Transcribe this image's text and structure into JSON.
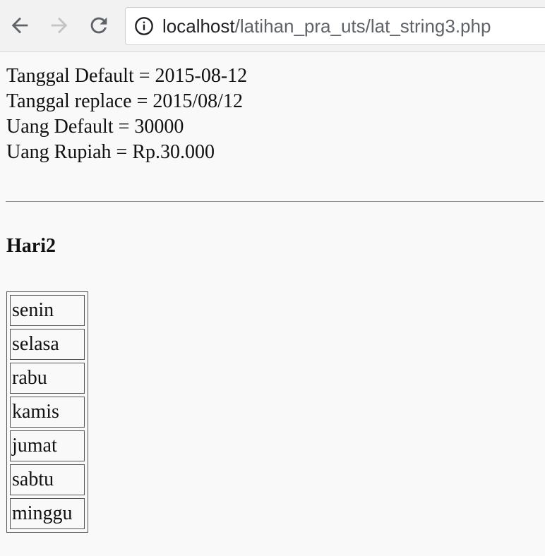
{
  "browser": {
    "url_host": "localhost",
    "url_path": "/latihan_pra_uts/lat_string3.php"
  },
  "content": {
    "lines": [
      "Tanggal Default = 2015-08-12",
      "Tanggal replace = 2015/08/12",
      "Uang Default = 30000",
      "Uang Rupiah = Rp.30.000"
    ],
    "heading": "Hari2",
    "days": [
      "senin",
      "selasa",
      "rabu",
      "kamis",
      "jumat",
      "sabtu",
      "minggu"
    ]
  }
}
